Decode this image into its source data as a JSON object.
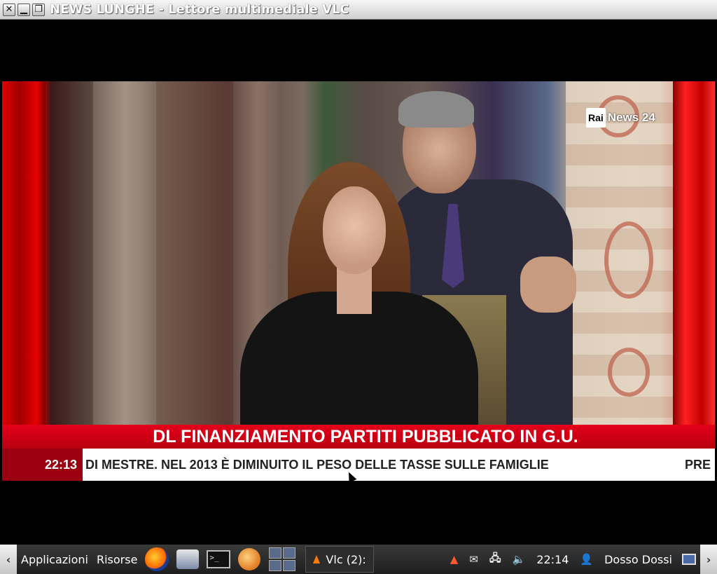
{
  "window": {
    "title": "NEWS LUNGHE - Lettore multimediale VLC",
    "close_glyph": "✕",
    "minimize_glyph": "▁",
    "maximize_glyph": "❐"
  },
  "video": {
    "logo_box": "Rai",
    "logo_text": "News 24",
    "headline": "DL FINANZIAMENTO PARTITI PUBBLICATO IN G.U.",
    "ticker_time": "22:13",
    "ticker_text": "DI MESTRE. NEL 2013 È DIMINUITO IL PESO DELLE TASSE SULLE FAMIGLIE",
    "ticker_next": "PRE"
  },
  "taskbar": {
    "scroll_left": "‹",
    "scroll_right": "›",
    "menu_apps": "Applicazioni",
    "menu_resources": "Risorse",
    "terminal_glyph": ">_",
    "task_vlc_label": "Vlc (2):",
    "clock": "22:14",
    "user_name": "Dosso Dossi",
    "user_glyph": "👤",
    "icons": [
      "firefox-icon",
      "files-icon",
      "terminal-icon",
      "shell-icon",
      "vlc-icon",
      "mail-icon",
      "network-icon",
      "volume-icon",
      "screen-icon"
    ],
    "tray_mail_glyph": "✉",
    "tray_network_glyph": "🖧",
    "tray_volume_glyph": "🔈"
  },
  "colors": {
    "headline_red": "#d0001a",
    "ticker_dark_red": "#9a0010",
    "taskbar_dark": "#2a2a2a"
  }
}
